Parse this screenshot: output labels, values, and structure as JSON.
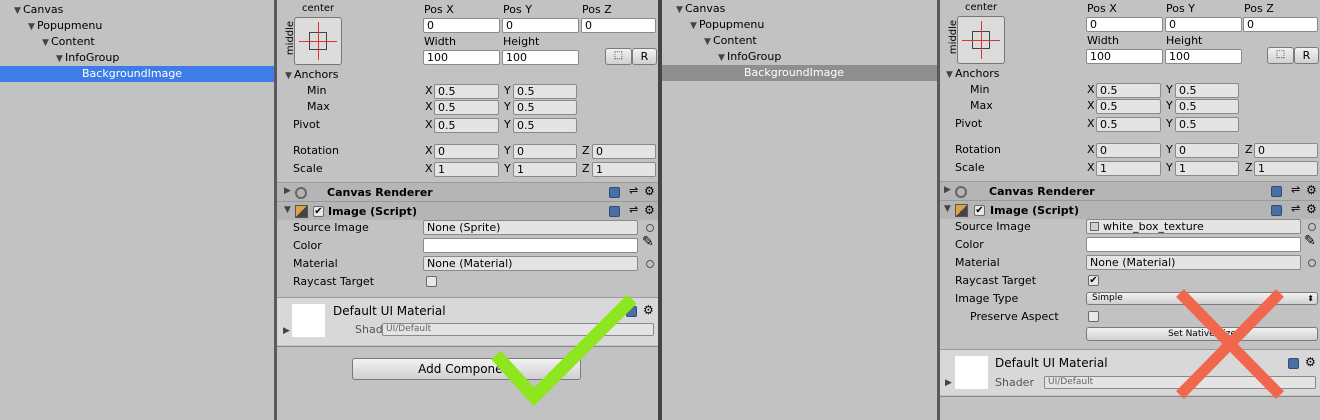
{
  "left": {
    "hierarchy": [
      {
        "label": "Canvas",
        "depth": 0,
        "selected": false
      },
      {
        "label": "Popupmenu",
        "depth": 1,
        "selected": false
      },
      {
        "label": "Content",
        "depth": 2,
        "selected": false
      },
      {
        "label": "InfoGroup",
        "depth": 3,
        "selected": false
      },
      {
        "label": "BackgroundImage",
        "depth": 4,
        "selected": true
      }
    ],
    "rect": {
      "anchor_h": "center",
      "anchor_v": "middle",
      "pos_x_label": "Pos X",
      "pos_y_label": "Pos Y",
      "pos_z_label": "Pos Z",
      "pos_x": "0",
      "pos_y": "0",
      "pos_z": "0",
      "width_label": "Width",
      "height_label": "Height",
      "width": "100",
      "height": "100",
      "r_button": "R",
      "anchors_label": "Anchors",
      "min_label": "Min",
      "max_label": "Max",
      "min_x": "0.5",
      "min_y": "0.5",
      "max_x": "0.5",
      "max_y": "0.5",
      "pivot_label": "Pivot",
      "pivot_x": "0.5",
      "pivot_y": "0.5",
      "rotation_label": "Rotation",
      "rot_x": "0",
      "rot_y": "0",
      "rot_z": "0",
      "scale_label": "Scale",
      "scale_x": "1",
      "scale_y": "1",
      "scale_z": "1",
      "x": "X",
      "y": "Y",
      "z": "Z"
    },
    "canvas_renderer": "Canvas Renderer",
    "image_script": "Image (Script)",
    "source_image_label": "Source Image",
    "source_image": "None (Sprite)",
    "color_label": "Color",
    "material_label": "Material",
    "material": "None (Material)",
    "raycast_label": "Raycast Target",
    "default_material": "Default UI Material",
    "shader_label": "Shader",
    "shader": "UI/Default",
    "add_component": "Add Component"
  },
  "right": {
    "hierarchy": [
      {
        "label": "Canvas",
        "depth": 0,
        "selected": false
      },
      {
        "label": "Popupmenu",
        "depth": 1,
        "selected": false
      },
      {
        "label": "Content",
        "depth": 2,
        "selected": false
      },
      {
        "label": "InfoGroup",
        "depth": 3,
        "selected": false
      },
      {
        "label": "BackgroundImage",
        "depth": 4,
        "selected": true
      }
    ],
    "rect": {
      "anchor_h": "center",
      "anchor_v": "middle",
      "pos_x_label": "Pos X",
      "pos_y_label": "Pos Y",
      "pos_z_label": "Pos Z",
      "pos_x": "0",
      "pos_y": "0",
      "pos_z": "0",
      "width_label": "Width",
      "height_label": "Height",
      "width": "100",
      "height": "100",
      "r_button": "R",
      "anchors_label": "Anchors",
      "min_label": "Min",
      "max_label": "Max",
      "min_x": "0.5",
      "min_y": "0.5",
      "max_x": "0.5",
      "max_y": "0.5",
      "pivot_label": "Pivot",
      "pivot_x": "0.5",
      "pivot_y": "0.5",
      "rotation_label": "Rotation",
      "rot_x": "0",
      "rot_y": "0",
      "rot_z": "0",
      "scale_label": "Scale",
      "scale_x": "1",
      "scale_y": "1",
      "scale_z": "1",
      "x": "X",
      "y": "Y",
      "z": "Z"
    },
    "canvas_renderer": "Canvas Renderer",
    "image_script": "Image (Script)",
    "source_image_label": "Source Image",
    "source_image": "white_box_texture",
    "color_label": "Color",
    "material_label": "Material",
    "material": "None (Material)",
    "raycast_label": "Raycast Target",
    "image_type_label": "Image Type",
    "image_type": "Simple",
    "preserve_label": "Preserve Aspect",
    "set_native": "Set Native Size",
    "default_material": "Default UI Material",
    "shader_label": "Shader",
    "shader": "UI/Default"
  },
  "colors": {
    "check_mark": "#8ee61e",
    "cross_mark": "#f0674e",
    "selection_blue": "#3e7de7",
    "selection_grey": "#8f8f8f"
  },
  "overlays": {
    "left": "check-mark-icon",
    "right": "cross-mark-icon"
  }
}
